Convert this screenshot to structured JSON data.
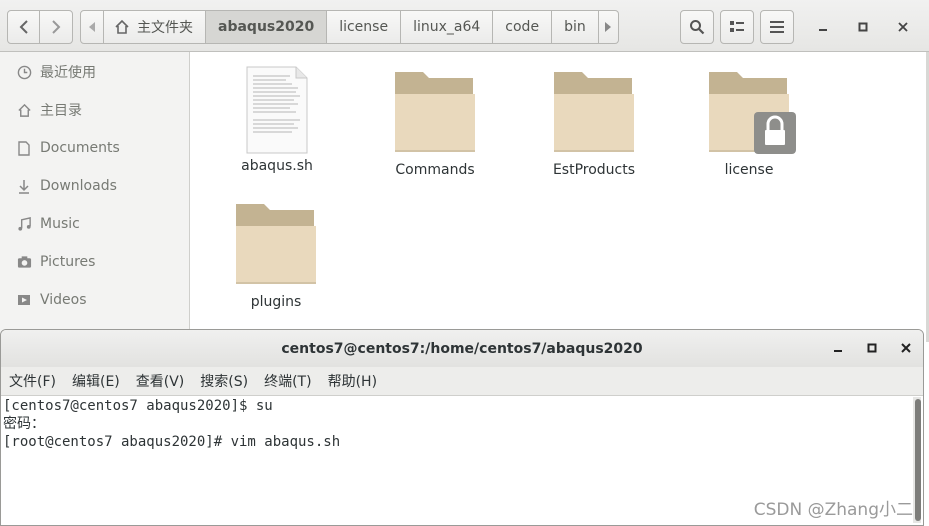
{
  "files_window": {
    "breadcrumbs": [
      "主文件夹",
      "abaqus2020",
      "license",
      "linux_a64",
      "code",
      "bin"
    ],
    "active_crumb": "abaqus2020",
    "sidebar": [
      {
        "label": "最近使用",
        "icon": "clock-icon"
      },
      {
        "label": "主目录",
        "icon": "home-icon"
      },
      {
        "label": "Documents",
        "icon": "document-icon"
      },
      {
        "label": "Downloads",
        "icon": "download-icon"
      },
      {
        "label": "Music",
        "icon": "music-icon"
      },
      {
        "label": "Pictures",
        "icon": "camera-icon"
      },
      {
        "label": "Videos",
        "icon": "video-icon"
      }
    ],
    "items": [
      {
        "name": "abaqus.sh",
        "type": "text-file"
      },
      {
        "name": "Commands",
        "type": "folder"
      },
      {
        "name": "EstProducts",
        "type": "folder"
      },
      {
        "name": "license",
        "type": "folder-locked"
      },
      {
        "name": "plugins",
        "type": "folder"
      }
    ]
  },
  "terminal": {
    "title": "centos7@centos7:/home/centos7/abaqus2020",
    "menu": [
      "文件(F)",
      "编辑(E)",
      "查看(V)",
      "搜索(S)",
      "终端(T)",
      "帮助(H)"
    ],
    "lines": [
      "[centos7@centos7 abaqus2020]$ su",
      "密码：",
      "[root@centos7 abaqus2020]# vim abaqus.sh"
    ]
  },
  "watermark": "CSDN @Zhang小二",
  "colors": {
    "folder_tab": "#c3b392",
    "folder_body": "#e9d9bd",
    "accent_grey": "#7d7d7a"
  }
}
